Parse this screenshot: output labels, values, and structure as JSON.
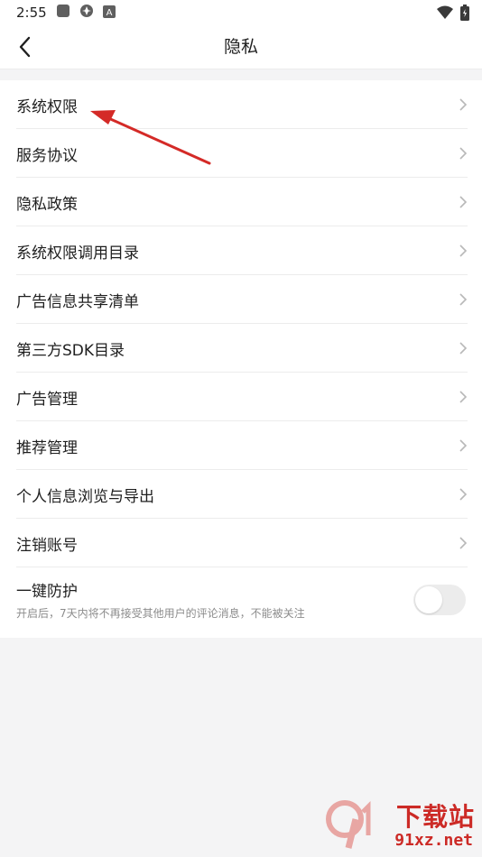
{
  "status_bar": {
    "time": "2:55",
    "icons": [
      "square-icon",
      "swirl-icon",
      "a-icon",
      "wifi-icon",
      "battery-icon"
    ]
  },
  "nav": {
    "title": "隐私",
    "back_icon": "back-chevron-icon"
  },
  "menu": {
    "items": [
      {
        "label": "系统权限"
      },
      {
        "label": "服务协议"
      },
      {
        "label": "隐私政策"
      },
      {
        "label": "系统权限调用目录"
      },
      {
        "label": "广告信息共享清单"
      },
      {
        "label": "第三方SDK目录"
      },
      {
        "label": "广告管理"
      },
      {
        "label": "推荐管理"
      },
      {
        "label": "个人信息浏览与导出"
      },
      {
        "label": "注销账号"
      }
    ]
  },
  "protection": {
    "label": "一键防护",
    "description": "开启后，7天内将不再接受其他用户的评论消息，不能被关注",
    "enabled": false
  },
  "watermark": {
    "title": "下载站",
    "url": "91xz.net"
  },
  "colors": {
    "accent_red": "#cc2a26",
    "page_bg": "#f4f4f5",
    "card_bg": "#ffffff",
    "divider": "#ececec"
  }
}
